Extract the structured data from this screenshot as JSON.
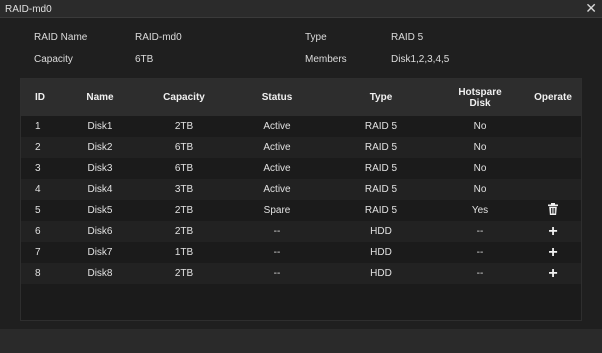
{
  "window": {
    "title": "RAID-md0",
    "close_icon": "close-icon"
  },
  "info": {
    "raid_name_label": "RAID Name",
    "raid_name_value": "RAID-md0",
    "type_label": "Type",
    "type_value": "RAID 5",
    "capacity_label": "Capacity",
    "capacity_value": "6TB",
    "members_label": "Members",
    "members_value": "Disk1,2,3,4,5"
  },
  "table": {
    "headers": {
      "id": "ID",
      "name": "Name",
      "capacity": "Capacity",
      "status": "Status",
      "type": "Type",
      "hotspare": "Hotspare Disk",
      "operate": "Operate"
    },
    "rows": [
      {
        "id": "1",
        "name": "Disk1",
        "capacity": "2TB",
        "status": "Active",
        "type": "RAID 5",
        "hotspare": "No",
        "operate": ""
      },
      {
        "id": "2",
        "name": "Disk2",
        "capacity": "6TB",
        "status": "Active",
        "type": "RAID 5",
        "hotspare": "No",
        "operate": ""
      },
      {
        "id": "3",
        "name": "Disk3",
        "capacity": "6TB",
        "status": "Active",
        "type": "RAID 5",
        "hotspare": "No",
        "operate": ""
      },
      {
        "id": "4",
        "name": "Disk4",
        "capacity": "3TB",
        "status": "Active",
        "type": "RAID 5",
        "hotspare": "No",
        "operate": ""
      },
      {
        "id": "5",
        "name": "Disk5",
        "capacity": "2TB",
        "status": "Spare",
        "type": "RAID 5",
        "hotspare": "Yes",
        "operate": "trash-icon"
      },
      {
        "id": "6",
        "name": "Disk6",
        "capacity": "2TB",
        "status": "--",
        "type": "HDD",
        "hotspare": "--",
        "operate": "plus-icon"
      },
      {
        "id": "7",
        "name": "Disk7",
        "capacity": "1TB",
        "status": "--",
        "type": "HDD",
        "hotspare": "--",
        "operate": "plus-icon"
      },
      {
        "id": "8",
        "name": "Disk8",
        "capacity": "2TB",
        "status": "--",
        "type": "HDD",
        "hotspare": "--",
        "operate": "plus-icon"
      }
    ]
  }
}
